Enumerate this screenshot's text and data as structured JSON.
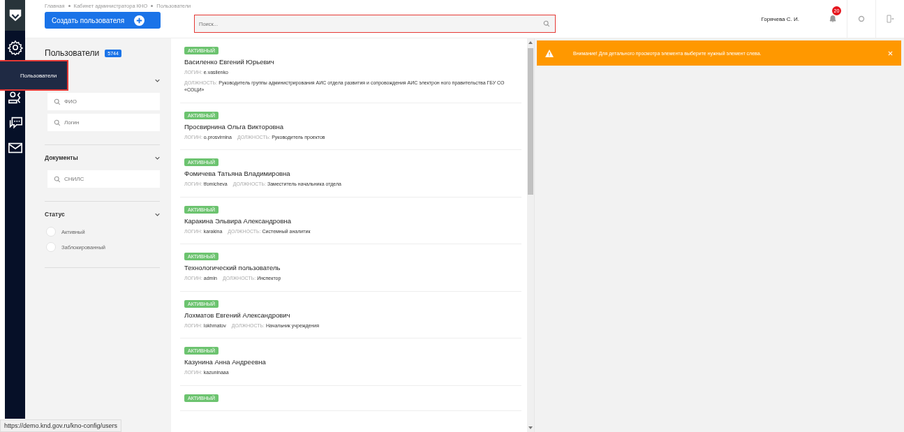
{
  "breadcrumbs": [
    "Главная",
    "Кабинет администратора КНО",
    "Пользователи"
  ],
  "create_button": {
    "label": "Создать пользователя"
  },
  "search": {
    "placeholder": "Поиск..."
  },
  "user_menu": {
    "name": "Горячева С. И.",
    "notifications": "20"
  },
  "rail": [
    {
      "kind": "logo"
    },
    {
      "kind": "settings"
    },
    {
      "kind": "users",
      "tooltip": "Пользователи"
    },
    {
      "kind": "user-check"
    },
    {
      "kind": "chat"
    },
    {
      "kind": "mail"
    }
  ],
  "filters": {
    "title": "Пользователи",
    "count": "5744",
    "sections": [
      {
        "expanded": true,
        "fields": [
          {
            "placeholder": "ФИО"
          },
          {
            "placeholder": "Логин"
          }
        ]
      },
      {
        "title": "Документы",
        "expanded": true,
        "fields": [
          {
            "placeholder": "СНИЛС"
          }
        ]
      },
      {
        "title": "Статус",
        "expanded": true,
        "options": [
          {
            "label": "Активный",
            "selected": false
          },
          {
            "label": "Заблокированный",
            "selected": false
          }
        ]
      }
    ]
  },
  "users": [
    {
      "status": "АКТИВНЫЙ",
      "name": "Василенко Евгений Юрьевич",
      "login_label": "ЛОГИН:",
      "login": "e.vasilenko",
      "position_label": "ДОЛЖНОСТЬ:",
      "position": "Руководитель группы администрирования АИС отдела развития и сопровождения АИС электрон ного правительства ГБУ СО «СОЦИ»"
    },
    {
      "status": "АКТИВНЫЙ",
      "name": "Просвирнина Ольга Викторовна",
      "login_label": "ЛОГИН:",
      "login": "o.prosvirnina",
      "position_label": "ДОЛЖНОСТЬ:",
      "position": "Руководитель проектов"
    },
    {
      "status": "АКТИВНЫЙ",
      "name": "Фомичева Татьяна Владимировна",
      "login_label": "ЛОГИН:",
      "login": "tfomicheva",
      "position_label": "ДОЛЖНОСТЬ:",
      "position": "Заместитель начальника отдела"
    },
    {
      "status": "АКТИВНЫЙ",
      "name": "Каракина Эльвира Александровна",
      "login_label": "ЛОГИН:",
      "login": "karakina",
      "position_label": "ДОЛЖНОСТЬ:",
      "position": "Системный аналитик"
    },
    {
      "status": "АКТИВНЫЙ",
      "name": "Технологический пользователь",
      "login_label": "ЛОГИН:",
      "login": "admin",
      "position_label": "ДОЛЖНОСТЬ:",
      "position": "Инспектор"
    },
    {
      "status": "АКТИВНЫЙ",
      "name": "Лохматов Евгений Александрович",
      "login_label": "ЛОГИН:",
      "login": "lokhmatov",
      "position_label": "ДОЛЖНОСТЬ:",
      "position": "Начальник учреждения"
    },
    {
      "status": "АКТИВНЫЙ",
      "name": "Казунина Анна Андреевна",
      "login_label": "ЛОГИН:",
      "login": "kazuninaaa"
    },
    {
      "status": "АКТИВНЫЙ"
    }
  ],
  "alert": {
    "text": "Внимание! Для детального просмотра элемента выберите нужный элемент слева."
  },
  "status_url": "https://demo.knd.gov.ru/kno-config/users"
}
